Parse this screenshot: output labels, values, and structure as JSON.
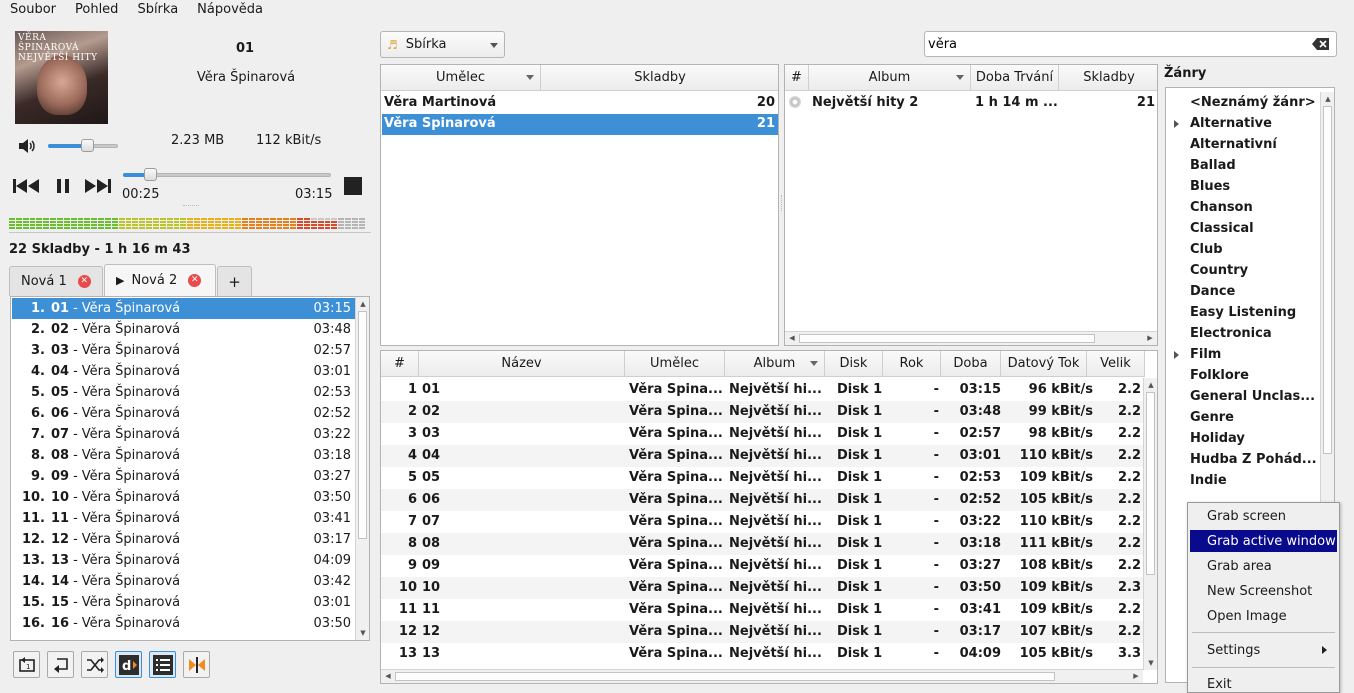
{
  "menubar": [
    "Soubor",
    "Pohled",
    "Sbírka",
    "Nápověda"
  ],
  "cover": {
    "text_line1": "VĚRA ŠPINAROVÁ",
    "text_line2": "NEJVĚTŠÍ HITY"
  },
  "now_playing": {
    "title": "01",
    "artist": "Věra Špinarová",
    "file_size": "2.23 MB",
    "bitrate": "112 kBit/s",
    "position": "00:25",
    "length": "03:15",
    "volume_level": 0.55,
    "progress": 0.13
  },
  "summary": "22 Skladby - 1 h 16 m 43",
  "tabs": [
    {
      "label": "Nová 1",
      "active": false
    },
    {
      "label": "Nová 2",
      "active": true
    }
  ],
  "add_tab_label": "+",
  "playlist": [
    {
      "n": "1.",
      "t": "01",
      "a": "Věra Špinarová",
      "d": "03:15",
      "sel": true
    },
    {
      "n": "2.",
      "t": "02",
      "a": "Věra Špinarová",
      "d": "03:48"
    },
    {
      "n": "3.",
      "t": "03",
      "a": "Věra Špinarová",
      "d": "02:57"
    },
    {
      "n": "4.",
      "t": "04",
      "a": "Věra Špinarová",
      "d": "03:01"
    },
    {
      "n": "5.",
      "t": "05",
      "a": "Věra Špinarová",
      "d": "02:53"
    },
    {
      "n": "6.",
      "t": "06",
      "a": "Věra Špinarová",
      "d": "02:52"
    },
    {
      "n": "7.",
      "t": "07",
      "a": "Věra Špinarová",
      "d": "03:22"
    },
    {
      "n": "8.",
      "t": "08",
      "a": "Věra Špinarová",
      "d": "03:18"
    },
    {
      "n": "9.",
      "t": "09",
      "a": "Věra Špinarová",
      "d": "03:27"
    },
    {
      "n": "10.",
      "t": "10",
      "a": "Věra Špinarová",
      "d": "03:50"
    },
    {
      "n": "11.",
      "t": "11",
      "a": "Věra Špinarová",
      "d": "03:41"
    },
    {
      "n": "12.",
      "t": "12",
      "a": "Věra Špinarová",
      "d": "03:17"
    },
    {
      "n": "13.",
      "t": "13",
      "a": "Věra Špinarová",
      "d": "04:09"
    },
    {
      "n": "14.",
      "t": "14",
      "a": "Věra Špinarová",
      "d": "03:42"
    },
    {
      "n": "15.",
      "t": "15",
      "a": "Věra Špinarová",
      "d": "03:01"
    },
    {
      "n": "16.",
      "t": "16",
      "a": "Věra Špinarová",
      "d": "03:50"
    }
  ],
  "collection_combo": "Sbírka",
  "search": {
    "value": "věra"
  },
  "artists_view": {
    "headers": [
      "Umělec",
      "Skladby"
    ],
    "rows": [
      {
        "artist": "Věra Martinová",
        "tracks": "20"
      },
      {
        "artist": "Věra Špinarová",
        "tracks": "21",
        "sel": true
      }
    ]
  },
  "albums_view": {
    "headers": [
      "#",
      "Album",
      "Doba Trvání",
      "Skladby"
    ],
    "rows": [
      {
        "album": "Největší hity 2",
        "duration": "1 h 14 m ...",
        "tracks": "21"
      }
    ]
  },
  "tracks_view": {
    "headers": [
      "#",
      "Název",
      "Umělec",
      "Album",
      "Disk",
      "Rok",
      "Doba",
      "Datový Tok",
      "Velik"
    ],
    "rows": [
      {
        "n": "1",
        "t": "01",
        "ar": "Věra Špina...",
        "al": "Největší hi...",
        "disk": "Disk 1",
        "rok": "-",
        "dur": "03:15",
        "br": "96 kBit/s",
        "sz": "2.2"
      },
      {
        "n": "2",
        "t": "02",
        "ar": "Věra Špina...",
        "al": "Největší hi...",
        "disk": "Disk 1",
        "rok": "-",
        "dur": "03:48",
        "br": "99 kBit/s",
        "sz": "2.2"
      },
      {
        "n": "3",
        "t": "03",
        "ar": "Věra Špina...",
        "al": "Největší hi...",
        "disk": "Disk 1",
        "rok": "-",
        "dur": "02:57",
        "br": "98 kBit/s",
        "sz": "2.2"
      },
      {
        "n": "4",
        "t": "04",
        "ar": "Věra Špina...",
        "al": "Největší hi...",
        "disk": "Disk 1",
        "rok": "-",
        "dur": "03:01",
        "br": "110 kBit/s",
        "sz": "2.2"
      },
      {
        "n": "5",
        "t": "05",
        "ar": "Věra Špina...",
        "al": "Největší hi...",
        "disk": "Disk 1",
        "rok": "-",
        "dur": "02:53",
        "br": "109 kBit/s",
        "sz": "2.2"
      },
      {
        "n": "6",
        "t": "06",
        "ar": "Věra Špina...",
        "al": "Největší hi...",
        "disk": "Disk 1",
        "rok": "-",
        "dur": "02:52",
        "br": "105 kBit/s",
        "sz": "2.2"
      },
      {
        "n": "7",
        "t": "07",
        "ar": "Věra Špina...",
        "al": "Největší hi...",
        "disk": "Disk 1",
        "rok": "-",
        "dur": "03:22",
        "br": "110 kBit/s",
        "sz": "2.2"
      },
      {
        "n": "8",
        "t": "08",
        "ar": "Věra Špina...",
        "al": "Největší hi...",
        "disk": "Disk 1",
        "rok": "-",
        "dur": "03:18",
        "br": "111 kBit/s",
        "sz": "2.2"
      },
      {
        "n": "9",
        "t": "09",
        "ar": "Věra Špina...",
        "al": "Největší hi...",
        "disk": "Disk 1",
        "rok": "-",
        "dur": "03:27",
        "br": "108 kBit/s",
        "sz": "2.2"
      },
      {
        "n": "10",
        "t": "10",
        "ar": "Věra Špina...",
        "al": "Největší hi...",
        "disk": "Disk 1",
        "rok": "-",
        "dur": "03:50",
        "br": "109 kBit/s",
        "sz": "2.3"
      },
      {
        "n": "11",
        "t": "11",
        "ar": "Věra Špina...",
        "al": "Největší hi...",
        "disk": "Disk 1",
        "rok": "-",
        "dur": "03:41",
        "br": "109 kBit/s",
        "sz": "2.2"
      },
      {
        "n": "12",
        "t": "12",
        "ar": "Věra Špina...",
        "al": "Největší hi...",
        "disk": "Disk 1",
        "rok": "-",
        "dur": "03:17",
        "br": "107 kBit/s",
        "sz": "2.2"
      },
      {
        "n": "13",
        "t": "13",
        "ar": "Věra Špina...",
        "al": "Největší hi...",
        "disk": "Disk 1",
        "rok": "-",
        "dur": "04:09",
        "br": "105 kBit/s",
        "sz": "3.3"
      }
    ]
  },
  "genres": {
    "label": "Žánry",
    "items": [
      {
        "name": "<Neznámý žánr>"
      },
      {
        "name": "Alternative",
        "expandable": true
      },
      {
        "name": "Alternativní"
      },
      {
        "name": "Ballad"
      },
      {
        "name": "Blues"
      },
      {
        "name": "Chanson"
      },
      {
        "name": "Classical"
      },
      {
        "name": "Club"
      },
      {
        "name": "Country"
      },
      {
        "name": "Dance"
      },
      {
        "name": "Easy Listening"
      },
      {
        "name": "Electronica"
      },
      {
        "name": "Film",
        "expandable": true
      },
      {
        "name": "Folklore"
      },
      {
        "name": "General Unclas..."
      },
      {
        "name": "Genre"
      },
      {
        "name": "Holiday"
      },
      {
        "name": "Hudba Z Pohád..."
      },
      {
        "name": "Indie"
      }
    ]
  },
  "context_menu": {
    "items": [
      "Grab screen",
      "Grab active window",
      "Grab area",
      "New Screenshot",
      "Open Image"
    ],
    "settings": "Settings",
    "exit": "Exit"
  },
  "colors": {
    "selection": "#3d8fd6",
    "menu_highlight": "#0a0a8c",
    "close_badge": "#e94a4a"
  }
}
